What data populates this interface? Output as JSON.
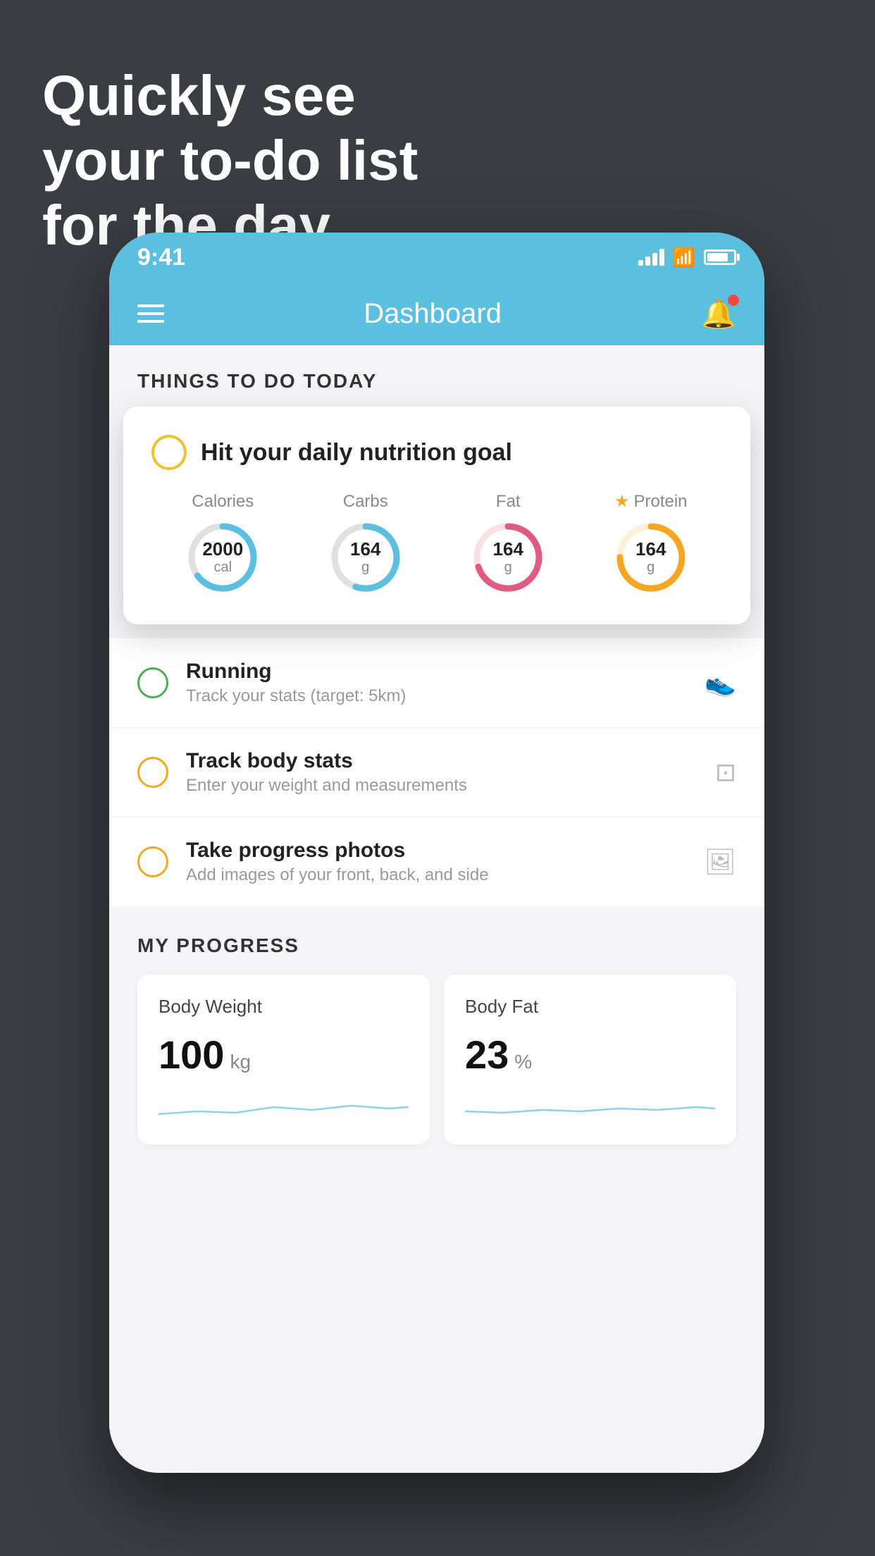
{
  "hero": {
    "line1": "Quickly see",
    "line2": "your to-do list",
    "line3": "for the day."
  },
  "status_bar": {
    "time": "9:41"
  },
  "header": {
    "title": "Dashboard"
  },
  "things_section": {
    "title": "THINGS TO DO TODAY"
  },
  "nutrition_card": {
    "title": "Hit your daily nutrition goal",
    "macros": [
      {
        "label": "Calories",
        "value": "2000",
        "unit": "cal",
        "color": "#5bbfe0",
        "track_color": "#e0e0e0",
        "pct": 65
      },
      {
        "label": "Carbs",
        "value": "164",
        "unit": "g",
        "color": "#5bbfe0",
        "track_color": "#e0e0e0",
        "pct": 55
      },
      {
        "label": "Fat",
        "value": "164",
        "unit": "g",
        "color": "#e05b7f",
        "track_color": "#f8e0e5",
        "pct": 70
      },
      {
        "label": "Protein",
        "value": "164",
        "unit": "g",
        "color": "#f5a623",
        "track_color": "#fdf0d5",
        "pct": 75,
        "starred": true
      }
    ]
  },
  "todo_items": [
    {
      "id": "running",
      "title": "Running",
      "subtitle": "Track your stats (target: 5km)",
      "circle_color": "green",
      "icon": "👟"
    },
    {
      "id": "body-stats",
      "title": "Track body stats",
      "subtitle": "Enter your weight and measurements",
      "circle_color": "yellow",
      "icon": "⚖"
    },
    {
      "id": "progress-photos",
      "title": "Take progress photos",
      "subtitle": "Add images of your front, back, and side",
      "circle_color": "yellow",
      "icon": "🖼"
    }
  ],
  "progress_section": {
    "title": "MY PROGRESS",
    "cards": [
      {
        "id": "body-weight",
        "title": "Body Weight",
        "value": "100",
        "unit": "kg"
      },
      {
        "id": "body-fat",
        "title": "Body Fat",
        "value": "23",
        "unit": "%"
      }
    ]
  }
}
